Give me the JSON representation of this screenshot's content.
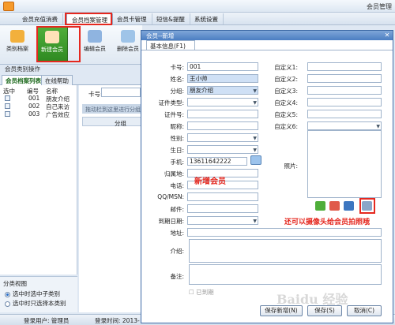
{
  "app": {
    "title": "会员管理"
  },
  "menu": {
    "tabs": [
      "会员充值消费",
      "会员档案管理",
      "会员卡管理",
      "短信&提醒",
      "系统设置"
    ]
  },
  "toolbar": {
    "buttons": [
      "类别档案",
      "新建会员",
      "编辑会员",
      "删除会员"
    ]
  },
  "left": {
    "op_label": "会员类别操作",
    "tabs": [
      "会员档案列表",
      "在线帮助"
    ],
    "tree_headers": [
      "选中",
      "编号",
      "名称"
    ],
    "tree_rows": [
      {
        "code": "001",
        "name": "朋友介绍"
      },
      {
        "code": "002",
        "name": "自己来访"
      },
      {
        "code": "003",
        "name": "广告效应"
      }
    ],
    "filter_title": "分类视图",
    "filter_options": [
      "选中时选中子类别",
      "选中时只选择本类别"
    ]
  },
  "middle": {
    "card_label": "卡号:",
    "grid_hint": "拖动栏到这里进行分组",
    "grid_col": "分组"
  },
  "status": {
    "user": "登录用户: 管理员",
    "time": "登录时间: 2013-"
  },
  "dialog": {
    "title": "会员--新增",
    "tab": "基本信息(F1)",
    "fields": {
      "card_no": {
        "label": "卡号:",
        "value": "001"
      },
      "name": {
        "label": "姓名:",
        "value": "王小帅"
      },
      "group": {
        "label": "分组:",
        "value": "朋友介绍"
      },
      "id_type": {
        "label": "证件类型:"
      },
      "id_no": {
        "label": "证件号:"
      },
      "nickname": {
        "label": "昵称:"
      },
      "gender": {
        "label": "性别:"
      },
      "birthday": {
        "label": "生日:"
      },
      "phone": {
        "label": "手机:",
        "value": "13611642222"
      },
      "location": {
        "label": "归属地:"
      },
      "tel": {
        "label": "电话:"
      },
      "qq": {
        "label": "QQ/MSN:"
      },
      "email": {
        "label": "邮件:"
      },
      "expire": {
        "label": "到期日期:"
      },
      "address": {
        "label": "地址:"
      },
      "intro": {
        "label": "介绍:"
      },
      "remark": {
        "label": "备注:"
      }
    },
    "custom_labels": [
      "自定义1:",
      "自定义2:",
      "自定义3:",
      "自定义4:",
      "自定义5:",
      "自定义6:"
    ],
    "photo_label": "照片:",
    "disabled_label": "已到期",
    "save_new": "保存新增(N)",
    "save": "保存(S)",
    "cancel": "取消(C)"
  },
  "annotations": {
    "new_member": "新增会员",
    "camera_tip": "还可以摄像头给会员拍照哦"
  },
  "watermark": "Baidu 经验",
  "colors": {
    "highlight": "#e5281f",
    "accent": "#4b7ec2",
    "new_button": "#3a9a2c"
  }
}
